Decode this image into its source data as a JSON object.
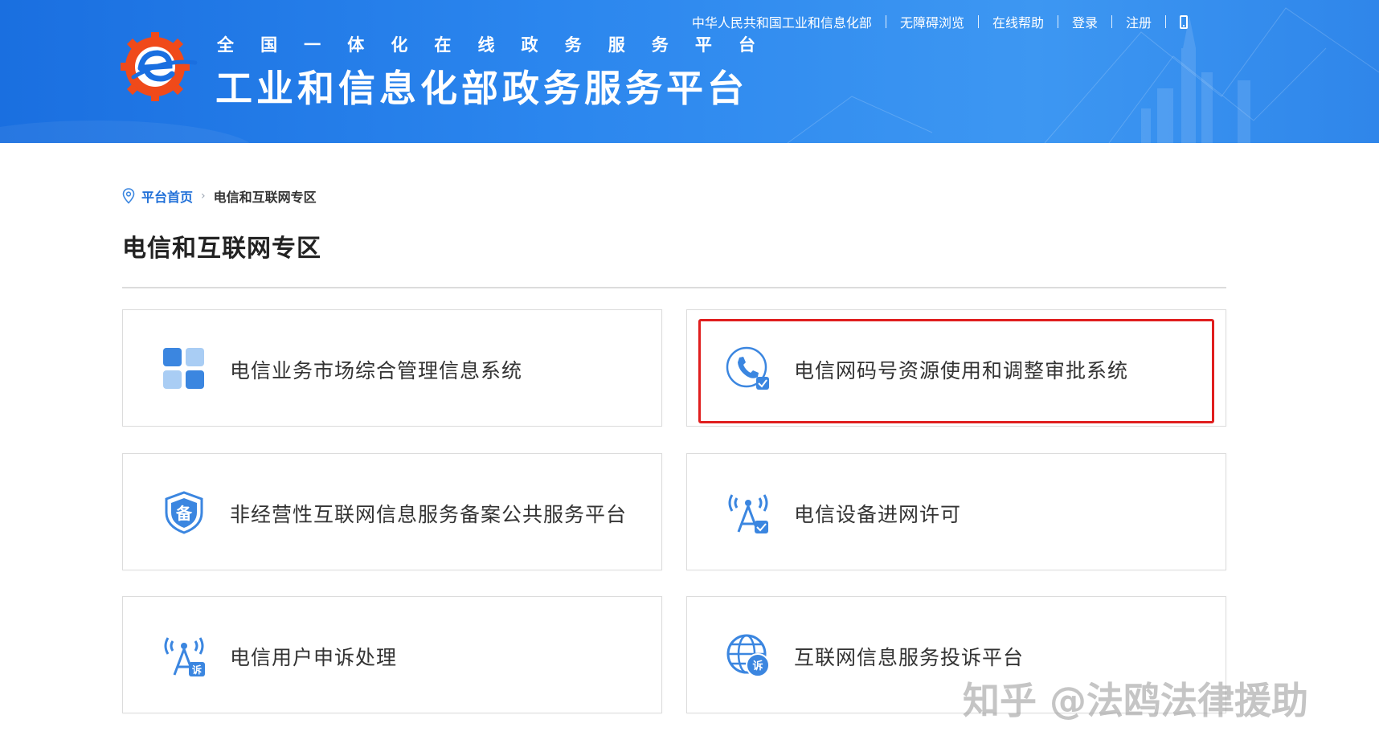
{
  "header": {
    "slogan_chars": [
      "全",
      "国",
      "一",
      "体",
      "化",
      "在",
      "线",
      "政",
      "务",
      "服",
      "务",
      "平",
      "台"
    ],
    "site_title": "工业和信息化部政务服务平台",
    "top_nav": {
      "ministry": "中华人民共和国工业和信息化部",
      "accessibility": "无障碍浏览",
      "help": "在线帮助",
      "login": "登录",
      "register": "注册"
    },
    "mobile_icon": "mobile-phone-icon"
  },
  "breadcrumb": {
    "icon": "location-pin-icon",
    "home": "平台首页",
    "separator": "›",
    "current": "电信和互联网专区"
  },
  "page_title": "电信和互联网专区",
  "cards": [
    {
      "label": "电信业务市场综合管理信息系统",
      "icon": "four-squares-icon"
    },
    {
      "label": "电信网码号资源使用和调整审批系统",
      "icon": "phone-check-icon",
      "highlighted": true
    },
    {
      "label": "非经营性互联网信息服务备案公共服务平台",
      "icon": "shield-bei-icon",
      "icon_text": "备"
    },
    {
      "label": "电信设备进网许可",
      "icon": "antenna-check-icon"
    },
    {
      "label": "电信用户申诉处理",
      "icon": "antenna-complaint-icon",
      "icon_text": "诉"
    },
    {
      "label": "互联网信息服务投诉平台",
      "icon": "globe-complaint-icon",
      "icon_text": "诉"
    }
  ],
  "watermark": "知乎 @法鸥法律援助",
  "colors": {
    "banner": "#2b86ee",
    "accent": "#1f6fd8",
    "icon_blue": "#3b86e0",
    "highlight": "#e01e1e"
  }
}
